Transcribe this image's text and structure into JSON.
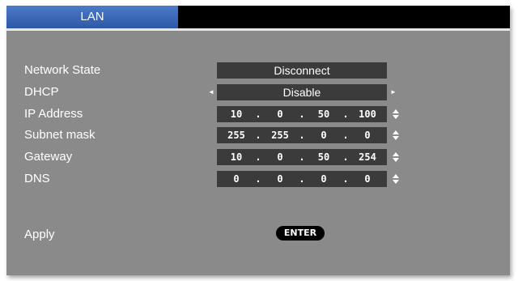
{
  "tabs": {
    "active": "LAN"
  },
  "rows": {
    "network_state": {
      "label": "Network State",
      "value": "Disconnect"
    },
    "dhcp": {
      "label": "DHCP",
      "value": "Disable",
      "left_arrow": "◄",
      "right_arrow": "►"
    },
    "ip_address": {
      "label": "IP Address",
      "octets": [
        "10",
        "0",
        "50",
        "100"
      ]
    },
    "subnet_mask": {
      "label": "Subnet mask",
      "octets": [
        "255",
        "255",
        "0",
        "0"
      ]
    },
    "gateway": {
      "label": "Gateway",
      "octets": [
        "10",
        "0",
        "50",
        "254"
      ]
    },
    "dns": {
      "label": "DNS",
      "octets": [
        "0",
        "0",
        "0",
        "0"
      ]
    },
    "apply": {
      "label": "Apply",
      "button": "ENTER"
    }
  },
  "separator": "."
}
